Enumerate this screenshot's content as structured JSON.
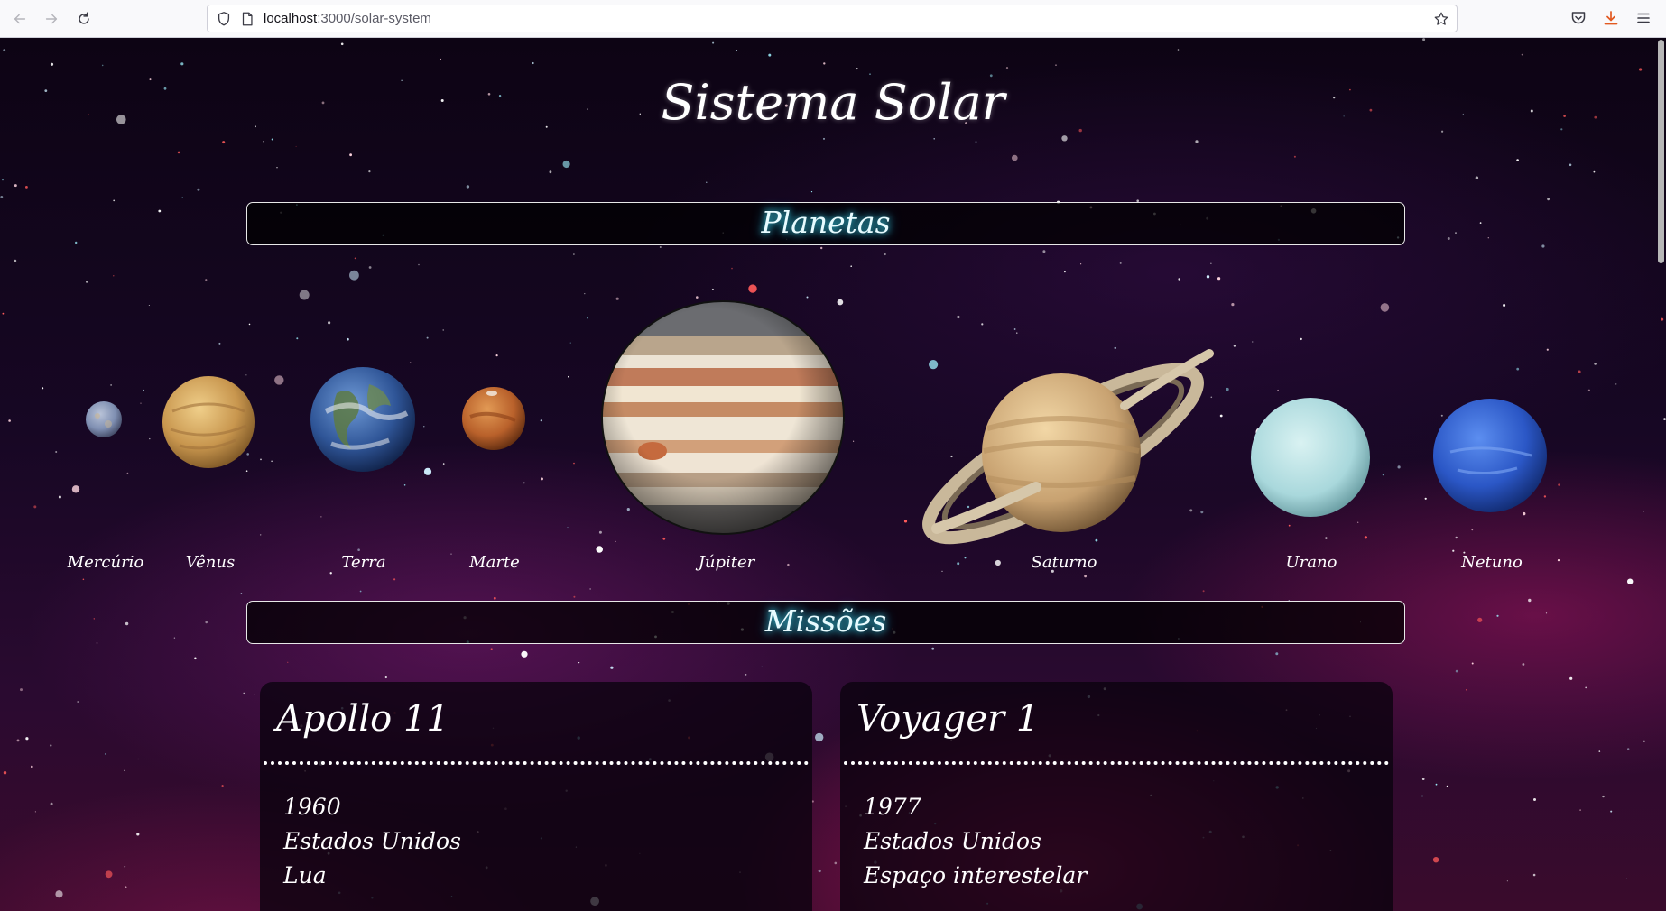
{
  "browser": {
    "url_host": "localhost",
    "url_path": ":3000/solar-system"
  },
  "page": {
    "title": "Sistema Solar",
    "sections": {
      "planets": "Planetas",
      "missions": "Missões"
    },
    "planets": [
      {
        "name": "Mercúrio",
        "icon": "mercury-image"
      },
      {
        "name": "Vênus",
        "icon": "venus-image"
      },
      {
        "name": "Terra",
        "icon": "earth-image"
      },
      {
        "name": "Marte",
        "icon": "mars-image"
      },
      {
        "name": "Júpiter",
        "icon": "jupiter-image"
      },
      {
        "name": "Saturno",
        "icon": "saturn-image"
      },
      {
        "name": "Urano",
        "icon": "uranus-image"
      },
      {
        "name": "Netuno",
        "icon": "neptune-image"
      }
    ],
    "missions": [
      {
        "name": "Apollo 11",
        "year": "1960",
        "country": "Estados Unidos",
        "destination": "Lua"
      },
      {
        "name": "Voyager 1",
        "year": "1977",
        "country": "Estados Unidos",
        "destination": "Espaço interestelar"
      }
    ]
  },
  "colors": {
    "section_glow": "#3fd2e8",
    "text": "#ffffff"
  }
}
